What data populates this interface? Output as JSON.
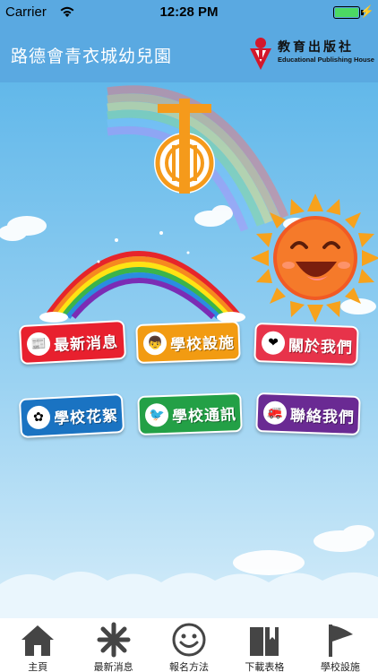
{
  "status_bar": {
    "carrier": "Carrier",
    "time": "12:28 PM"
  },
  "header": {
    "title": "路德會青衣城幼兒園",
    "publisher_name": "教育出版社",
    "publisher_name_en": "Educational Publishing House"
  },
  "menu": [
    {
      "label": "最新消息",
      "icon": "newspaper-icon",
      "color": "#e8202e"
    },
    {
      "label": "學校設施",
      "icon": "child-icon",
      "color": "#f29b12"
    },
    {
      "label": "關於我們",
      "icon": "heart-icon",
      "color": "#e7334a"
    },
    {
      "label": "學校花絮",
      "icon": "flower-icon",
      "color": "#1a73c2"
    },
    {
      "label": "學校通訊",
      "icon": "bird-icon",
      "color": "#23a046"
    },
    {
      "label": "聯絡我們",
      "icon": "hydrant-icon",
      "color": "#6a2a93"
    }
  ],
  "tabs": [
    {
      "label": "主頁",
      "icon": "home-icon"
    },
    {
      "label": "最新消息",
      "icon": "asterisk-icon"
    },
    {
      "label": "報名方法",
      "icon": "smiley-icon"
    },
    {
      "label": "下載表格",
      "icon": "book-icon"
    },
    {
      "label": "學校設施",
      "icon": "flag-icon"
    }
  ]
}
